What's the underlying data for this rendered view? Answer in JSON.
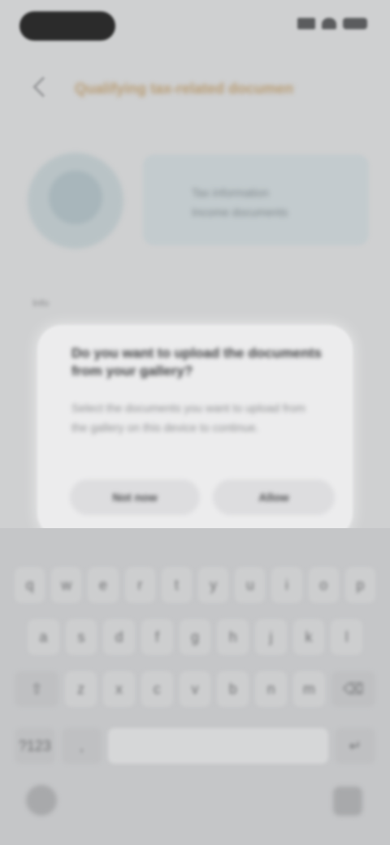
{
  "app_bar": {
    "title": "Qualifying tax-related documents"
  },
  "profile": {
    "info_line1": "Tax information",
    "info_line2": "Income documents"
  },
  "section": {
    "label": "Info"
  },
  "dialog": {
    "title": "Do you want to upload the documents from your gallery?",
    "body": "Select the documents you want to upload from the gallery on this device to continue.",
    "secondary_button": "Not now",
    "primary_button": "Allow"
  },
  "keyboard": {
    "row1": [
      "q",
      "w",
      "e",
      "r",
      "t",
      "y",
      "u",
      "i",
      "o",
      "p"
    ],
    "row2": [
      "a",
      "s",
      "d",
      "f",
      "g",
      "h",
      "j",
      "k",
      "l"
    ],
    "row3": [
      "z",
      "x",
      "c",
      "v",
      "b",
      "n",
      "m"
    ],
    "shift_label": "⇧",
    "backspace_label": "⌫",
    "mode_label": "?123",
    "emoji_label": ",",
    "space_label": "",
    "enter_label": "↵"
  },
  "colors": {
    "background": "#cfd0d1",
    "dialog_bg": "#ececed",
    "title_accent": "#b79a70",
    "keyboard_bg": "#c5c6c8"
  },
  "icons": {
    "back": "back-arrow-icon",
    "signal": "signal-icon",
    "wifi": "wifi-icon",
    "battery": "battery-icon",
    "nav_left": "keyboard-hide-icon",
    "nav_right": "ime-switch-icon"
  }
}
